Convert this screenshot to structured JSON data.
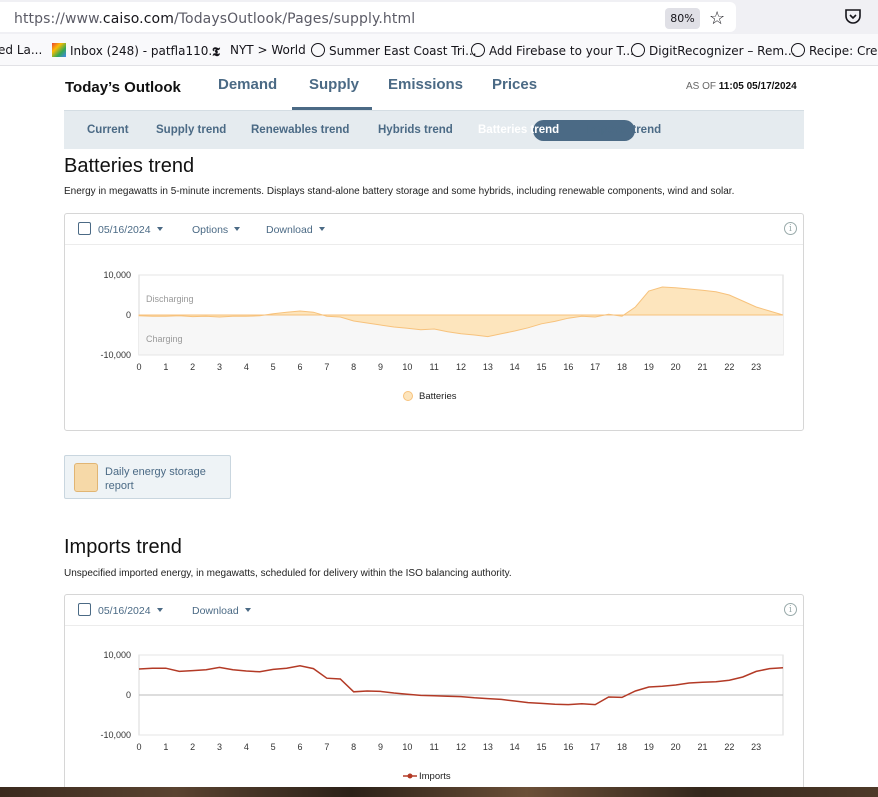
{
  "browser": {
    "url_prefix": "https://www.",
    "url_host": "caiso.com",
    "url_path": "/TodaysOutlook/Pages/supply.html",
    "zoom": "80%",
    "bookmarks": [
      "ed La...",
      "Inbox (248) - patfla110...",
      "NYT > World",
      "Summer East Coast Tri...",
      "Add Firebase to your T...",
      "DigitRecognizer – Rem...",
      "Recipe: Crea"
    ]
  },
  "nav": {
    "title": "Today’s Outlook",
    "tabs": [
      "Demand",
      "Supply",
      "Emissions",
      "Prices"
    ],
    "active_tab": "Supply",
    "as_of_label": "AS OF",
    "as_of_value": "11:05 05/17/2024"
  },
  "subnav": {
    "tabs": [
      "Current",
      "Supply trend",
      "Renewables trend",
      "Hybrids trend",
      "Batteries trend",
      "Imports trend"
    ],
    "active": "Batteries trend"
  },
  "batteries": {
    "title": "Batteries trend",
    "description": "Energy in megawatts in 5-minute increments. Displays stand-alone battery storage and some hybrids, including renewable components, wind and solar.",
    "date": "05/16/2024",
    "options_label": "Options",
    "download_label": "Download",
    "discharging_label": "Discharging",
    "charging_label": "Charging"
  },
  "report": {
    "label": "Daily energy storage report"
  },
  "imports": {
    "title": "Imports trend",
    "description": "Unspecified imported energy, in megawatts, scheduled for delivery within the ISO balancing authority.",
    "date": "05/16/2024",
    "download_label": "Download"
  },
  "colors": {
    "battery_fill": "#fde5bd",
    "battery_line": "#f7c27c",
    "imports_line": "#b33a26",
    "accent": "#4b6a85"
  },
  "chart_data": [
    {
      "type": "area",
      "series": [
        {
          "name": "Batteries",
          "x": [
            0,
            0.5,
            1,
            1.5,
            2,
            2.5,
            3,
            3.5,
            4,
            4.5,
            5,
            5.5,
            6,
            6.5,
            7,
            7.5,
            8,
            8.5,
            9,
            9.5,
            10,
            10.5,
            11,
            11.5,
            12,
            12.5,
            13,
            13.5,
            14,
            14.5,
            15,
            15.5,
            16,
            16.5,
            17,
            17.5,
            18,
            18.5,
            19,
            19.5,
            20,
            20.5,
            21,
            21.5,
            22,
            22.5,
            23,
            23.5,
            24
          ],
          "values": [
            -200,
            -300,
            -300,
            -200,
            -400,
            -300,
            -500,
            -300,
            -300,
            -200,
            300,
            700,
            1000,
            700,
            -300,
            -500,
            -1500,
            -2000,
            -2500,
            -3000,
            -3300,
            -3700,
            -3500,
            -4200,
            -4700,
            -5000,
            -5400,
            -4700,
            -4000,
            -3200,
            -2200,
            -1600,
            -800,
            -300,
            -500,
            200,
            -300,
            2000,
            6000,
            7000,
            6800,
            6500,
            6200,
            5800,
            5000,
            3500,
            2000,
            1000,
            0
          ]
        }
      ],
      "ylim": [
        -10000,
        10000
      ],
      "y_ticks": [
        "10,000",
        "0",
        "-10,000"
      ],
      "x_ticks": [
        "0",
        "1",
        "2",
        "3",
        "4",
        "5",
        "6",
        "7",
        "8",
        "9",
        "10",
        "11",
        "12",
        "13",
        "14",
        "15",
        "16",
        "17",
        "18",
        "19",
        "20",
        "21",
        "22",
        "23"
      ],
      "legend": "bottom-center",
      "grid": true
    },
    {
      "type": "line",
      "series": [
        {
          "name": "Imports",
          "x": [
            0,
            0.5,
            1,
            1.5,
            2,
            2.5,
            3,
            3.5,
            4,
            4.5,
            5,
            5.5,
            6,
            6.5,
            7,
            7.5,
            8,
            8.5,
            9,
            9.5,
            10,
            10.5,
            11,
            11.5,
            12,
            12.5,
            13,
            13.5,
            14,
            14.5,
            15,
            15.5,
            16,
            16.5,
            17,
            17.5,
            18,
            18.5,
            19,
            19.5,
            20,
            20.5,
            21,
            21.5,
            22,
            22.5,
            23,
            23.5,
            24
          ],
          "values": [
            6500,
            6700,
            6700,
            5900,
            6100,
            6300,
            6900,
            6300,
            6000,
            5800,
            6400,
            6700,
            7300,
            6600,
            4200,
            4000,
            800,
            1000,
            900,
            500,
            200,
            -100,
            -200,
            -300,
            -400,
            -700,
            -900,
            -1100,
            -1500,
            -1900,
            -2100,
            -2300,
            -2400,
            -2200,
            -2400,
            -500,
            -600,
            1000,
            2000,
            2200,
            2500,
            3000,
            3200,
            3300,
            3700,
            4500,
            5900,
            6600,
            6800
          ]
        }
      ],
      "ylim": [
        -10000,
        10000
      ],
      "y_ticks": [
        "10,000",
        "0",
        "-10,000"
      ],
      "x_ticks": [
        "0",
        "1",
        "2",
        "3",
        "4",
        "5",
        "6",
        "7",
        "8",
        "9",
        "10",
        "11",
        "12",
        "13",
        "14",
        "15",
        "16",
        "17",
        "18",
        "19",
        "20",
        "21",
        "22",
        "23"
      ],
      "legend": "bottom-center",
      "grid": true
    }
  ]
}
